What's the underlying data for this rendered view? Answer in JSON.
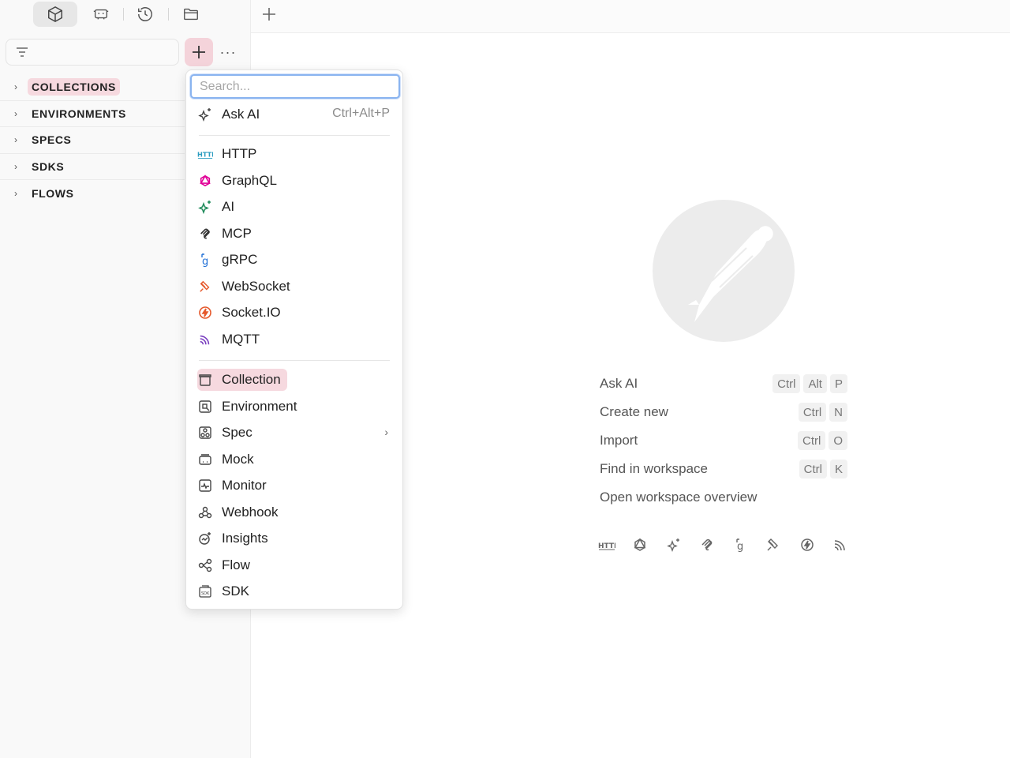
{
  "toolbar": {
    "icons": [
      "collections-cube-icon",
      "environments-icon",
      "history-icon",
      "folder-icon"
    ],
    "new_tab_label": "+"
  },
  "sidebar": {
    "filter_placeholder": "",
    "items": [
      {
        "label": "COLLECTIONS",
        "highlighted": true
      },
      {
        "label": "ENVIRONMENTS",
        "highlighted": false
      },
      {
        "label": "SPECS",
        "highlighted": false
      },
      {
        "label": "SDKS",
        "highlighted": false
      },
      {
        "label": "FLOWS",
        "highlighted": false
      }
    ]
  },
  "dropdown": {
    "search_placeholder": "Search...",
    "ask_ai": {
      "label": "Ask AI",
      "shortcut": "Ctrl+Alt+P"
    },
    "protocols": [
      {
        "label": "HTTP",
        "icon": "http-icon",
        "color": "#2a9cc0"
      },
      {
        "label": "GraphQL",
        "icon": "graphql-icon",
        "color": "#e10098"
      },
      {
        "label": "AI",
        "icon": "ai-sparkle-icon",
        "color": "#1e8a5a"
      },
      {
        "label": "MCP",
        "icon": "mcp-icon",
        "color": "#333333"
      },
      {
        "label": "gRPC",
        "icon": "grpc-icon",
        "color": "#1f6fd6"
      },
      {
        "label": "WebSocket",
        "icon": "websocket-icon",
        "color": "#e5582b"
      },
      {
        "label": "Socket.IO",
        "icon": "socketio-icon",
        "color": "#e5582b"
      },
      {
        "label": "MQTT",
        "icon": "mqtt-icon",
        "color": "#7a3fc0"
      }
    ],
    "entities": [
      {
        "label": "Collection",
        "icon": "collection-icon",
        "highlighted": true
      },
      {
        "label": "Environment",
        "icon": "environment-icon"
      },
      {
        "label": "Spec",
        "icon": "spec-icon",
        "submenu": true
      },
      {
        "label": "Mock",
        "icon": "mock-icon"
      },
      {
        "label": "Monitor",
        "icon": "monitor-icon"
      },
      {
        "label": "Webhook",
        "icon": "webhook-icon"
      },
      {
        "label": "Insights",
        "icon": "insights-icon"
      },
      {
        "label": "Flow",
        "icon": "flow-icon"
      },
      {
        "label": "SDK",
        "icon": "sdk-icon"
      }
    ]
  },
  "main": {
    "shortcuts": [
      {
        "label": "Ask AI",
        "keys": [
          "Ctrl",
          "Alt",
          "P"
        ]
      },
      {
        "label": "Create new",
        "keys": [
          "Ctrl",
          "N"
        ]
      },
      {
        "label": "Import",
        "keys": [
          "Ctrl",
          "O"
        ]
      },
      {
        "label": "Find in workspace",
        "keys": [
          "Ctrl",
          "K"
        ]
      },
      {
        "label": "Open workspace overview",
        "keys": []
      }
    ],
    "protocol_icons": [
      "http-icon",
      "graphql-icon",
      "ai-sparkle-icon",
      "mcp-icon",
      "grpc-icon",
      "websocket-icon",
      "socketio-icon",
      "mqtt-icon"
    ]
  }
}
